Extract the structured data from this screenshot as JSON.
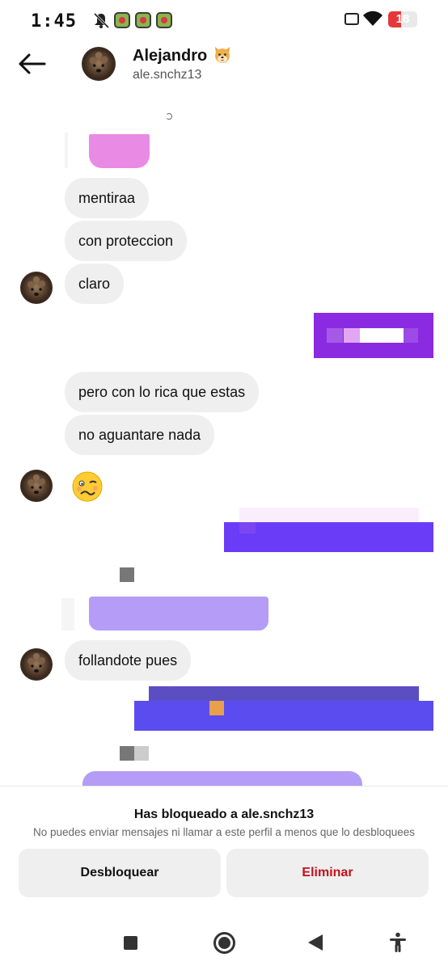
{
  "status_bar": {
    "time": "1:45",
    "battery_level": "18",
    "icons": [
      "mute-icon",
      "notification-app-icon",
      "notification-app-icon",
      "notification-app-icon",
      "sim-icon",
      "wifi-icon",
      "battery-icon"
    ]
  },
  "header": {
    "name": "Alejandro",
    "username": "ale.snchz13",
    "name_emoji": "dog-face-icon"
  },
  "messages": [
    {
      "from": "contact",
      "text": "mentiraa"
    },
    {
      "from": "contact",
      "text": "con proteccion"
    },
    {
      "from": "contact",
      "text": "claro"
    },
    {
      "from": "contact",
      "text": "pero con lo rica que estas"
    },
    {
      "from": "contact",
      "text": "no aguantare nada"
    },
    {
      "from": "contact",
      "text": "woozy-face-icon"
    },
    {
      "from": "contact",
      "text": "follandote pues"
    }
  ],
  "blocked_panel": {
    "title": "Has bloqueado a ale.snchz13",
    "subtitle": "No puedes enviar mensajes ni llamar a este perfil a menos que lo desbloquees",
    "unblock_label": "Desbloquear",
    "delete_label": "Eliminar"
  },
  "colors": {
    "contact_bubble": "#efefef",
    "sent_purple": "#8a2be2",
    "sent_violet": "#6a3cf7",
    "sent_lavender": "#b49cf7",
    "sent_indigo": "#5b4cf0",
    "delete_red": "#c4111b"
  },
  "nav_bar": {
    "icons": [
      "recents-icon",
      "home-icon",
      "back-icon",
      "accessibility-icon"
    ]
  }
}
